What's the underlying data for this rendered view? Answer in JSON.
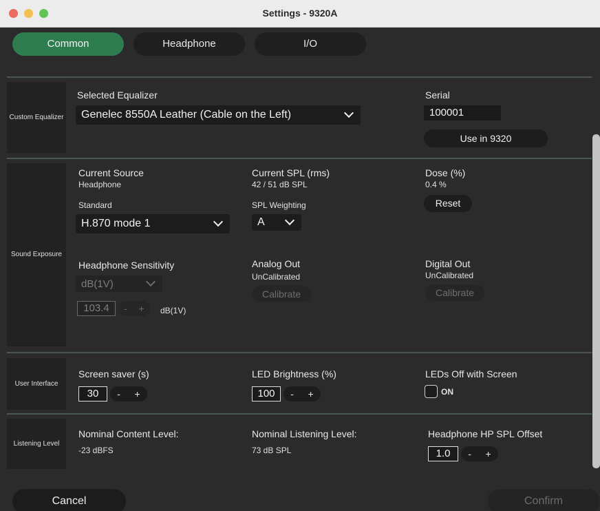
{
  "window": {
    "title": "Settings - 9320A"
  },
  "tabs": [
    {
      "label": "Common",
      "active": true
    },
    {
      "label": "Headphone",
      "active": false
    },
    {
      "label": "I/O",
      "active": false
    }
  ],
  "custom_equalizer": {
    "section_label": "Custom Equalizer",
    "selected_label": "Selected Equalizer",
    "selected_value": "Genelec 8550A Leather (Cable on the Left)",
    "serial_label": "Serial",
    "serial_value": "100001",
    "use_button": "Use in 9320"
  },
  "sound_exposure": {
    "section_label": "Sound Exposure",
    "current_source_label": "Current Source",
    "current_source_value": "Headphone",
    "current_spl_label": "Current SPL (rms)",
    "current_spl_value": "42  / 51 dB SPL",
    "dose_label": "Dose (%)",
    "dose_value": "0.4 %",
    "reset_button": "Reset",
    "standard_label": "Standard",
    "standard_value": "H.870 mode 1",
    "spl_weighting_label": "SPL Weighting",
    "spl_weighting_value": "A",
    "hp_sensitivity_label": "Headphone Sensitivity",
    "hp_sensitivity_unit_select": "dB(1V)",
    "hp_sensitivity_value": "103.4",
    "hp_sensitivity_unit": "dB(1V)",
    "analog_out_label": "Analog Out",
    "analog_out_status": "UnCalibrated",
    "analog_calibrate": "Calibrate",
    "digital_out_label": "Digital Out",
    "digital_out_status": "UnCalibrated",
    "digital_calibrate": "Calibrate"
  },
  "user_interface": {
    "section_label": "User Interface",
    "screen_saver_label": "Screen saver (s)",
    "screen_saver_value": "30",
    "led_brightness_label": "LED Brightness (%)",
    "led_brightness_value": "100",
    "leds_off_label": "LEDs Off with Screen",
    "leds_off_value": "ON"
  },
  "listening_level": {
    "section_label": "Listening Level",
    "nominal_content_label": "Nominal Content Level:",
    "nominal_content_value": "-23 dBFS",
    "nominal_listening_label": "Nominal Listening Level:",
    "nominal_listening_value": "73 dB SPL",
    "hp_spl_offset_label": "Headphone HP SPL Offset",
    "hp_spl_offset_value": "1.0"
  },
  "stepper": {
    "minus": "-",
    "plus": "+"
  },
  "footer": {
    "cancel": "Cancel",
    "confirm": "Confirm"
  },
  "colors": {
    "accent_tab": "#2e7d4f",
    "background": "#2b2b2b"
  }
}
